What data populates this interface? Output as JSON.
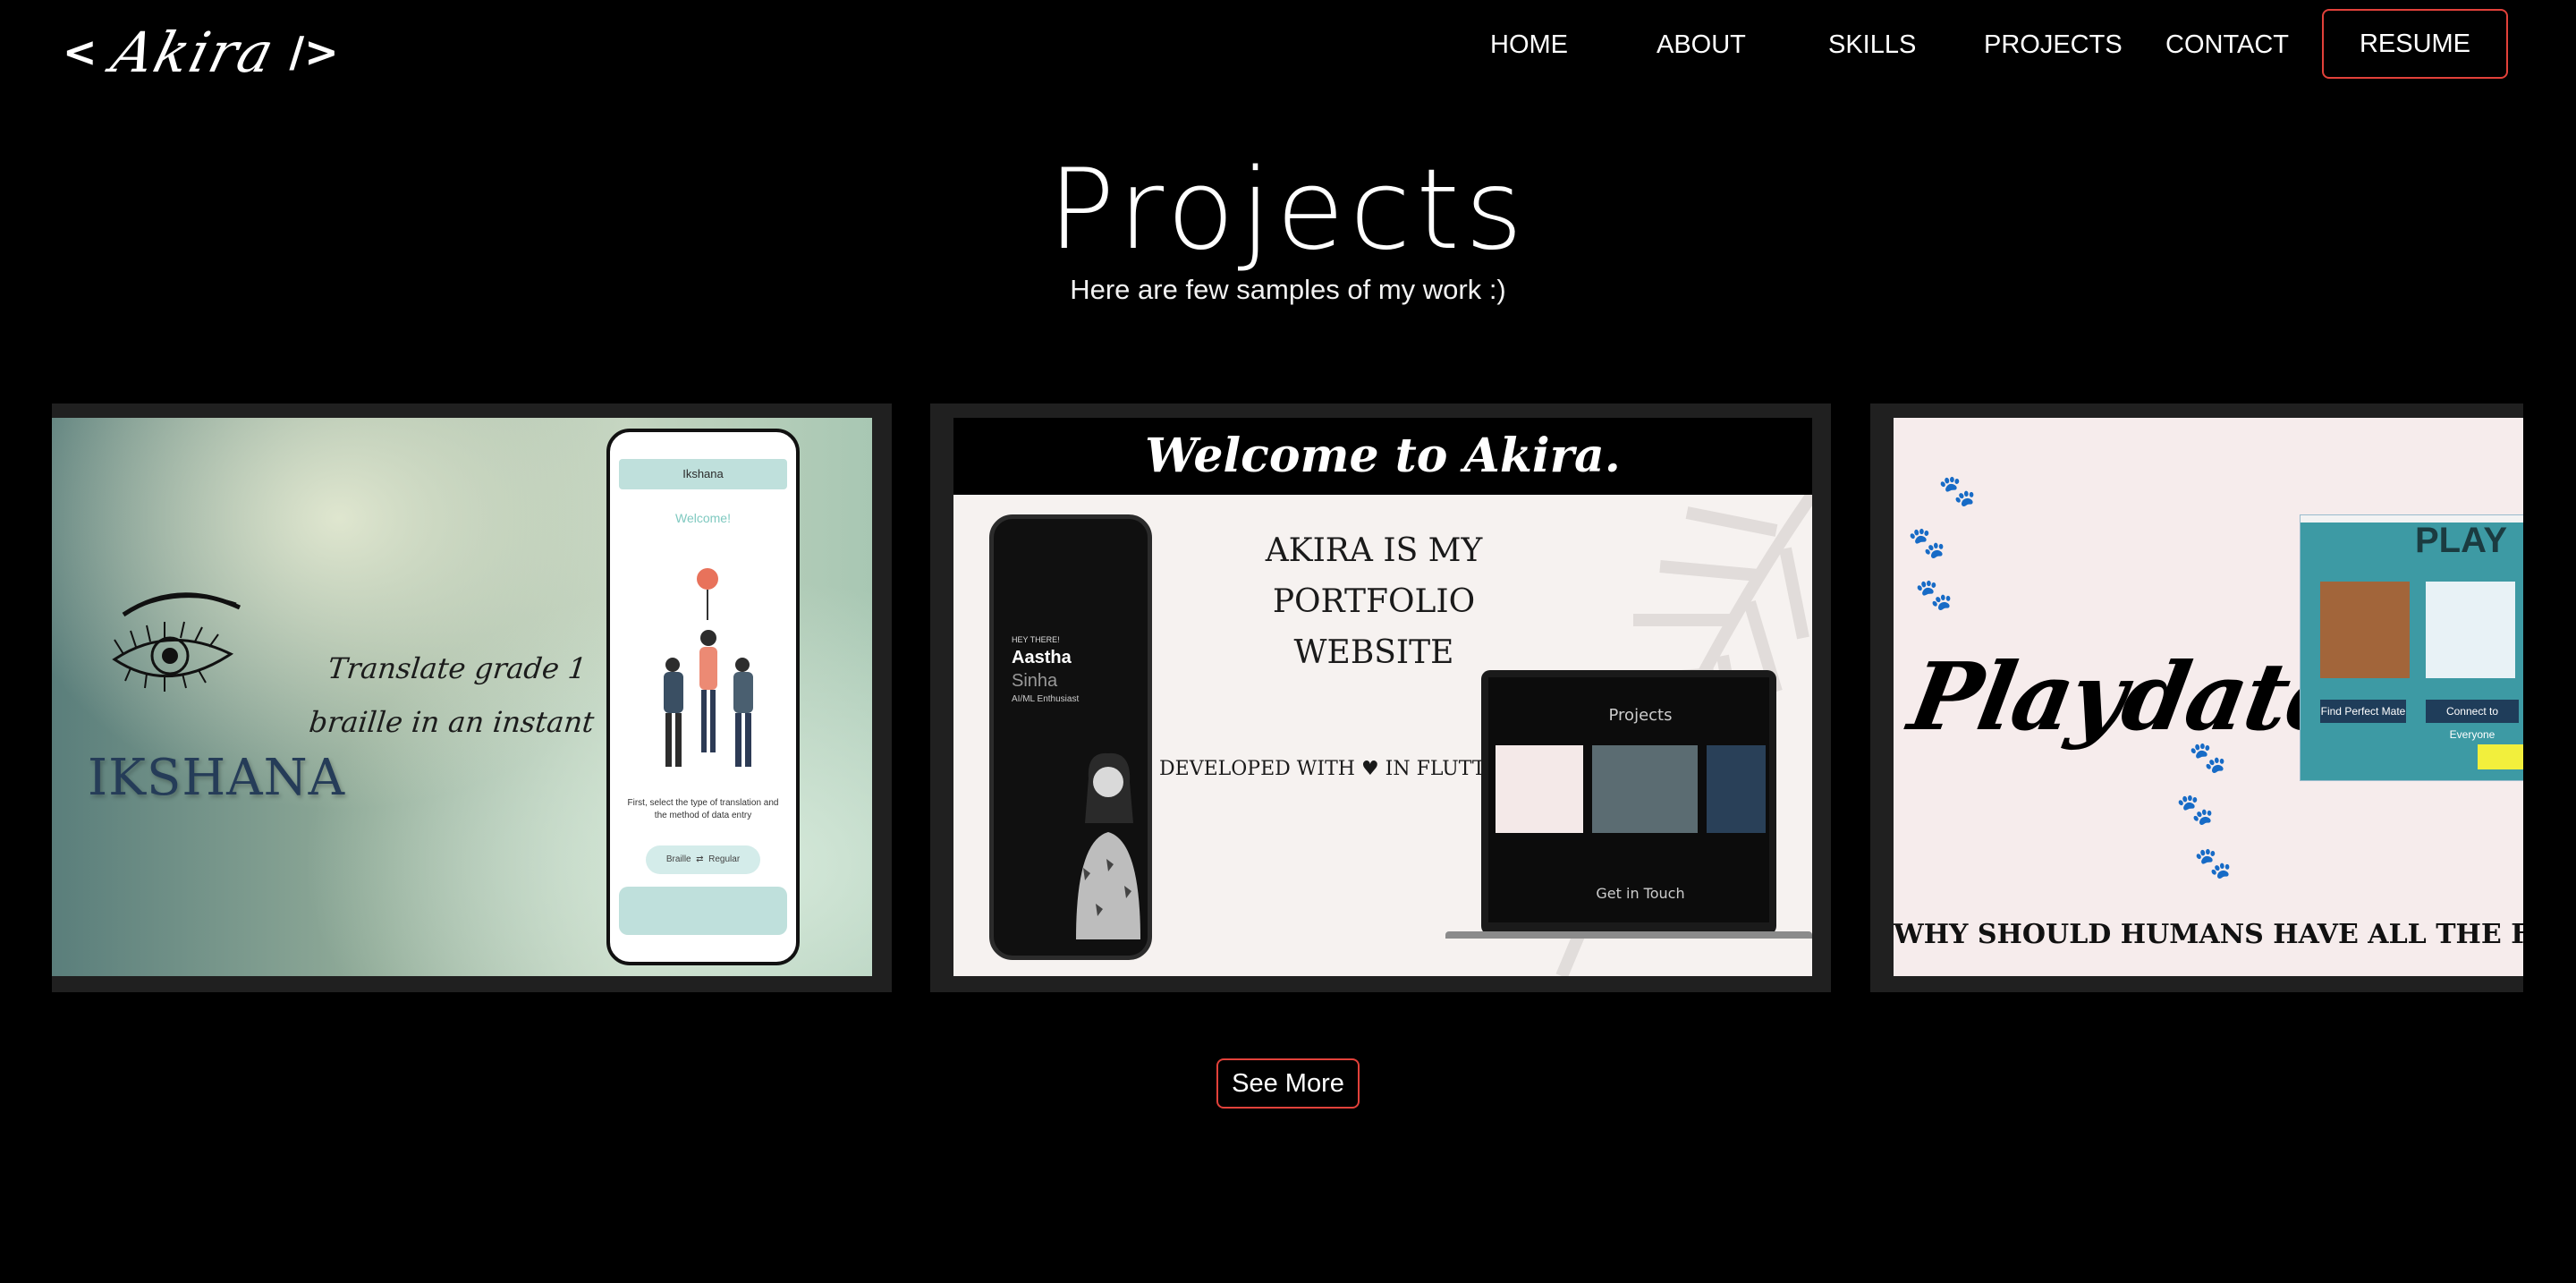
{
  "logo": {
    "open": "<",
    "signature": "Akira",
    "close": "/>"
  },
  "nav": {
    "items": [
      {
        "label": "HOME"
      },
      {
        "label": "ABOUT"
      },
      {
        "label": "SKILLS"
      },
      {
        "label": "PROJECTS"
      },
      {
        "label": "CONTACT"
      }
    ],
    "resume_label": "RESUME"
  },
  "hero": {
    "title": "Projects",
    "subtitle": "Here are few samples of my work :)"
  },
  "projects": [
    {
      "name": "IKSHANA",
      "tagline": "Translate grade 1 braille in an instant",
      "phone": {
        "app_title": "Ikshana",
        "welcome": "Welcome!",
        "hint": "First, select the type of translation and the method of data entry",
        "toggle_left": "Braille",
        "toggle_right": "Regular"
      }
    },
    {
      "banner": "Welcome to Akira.",
      "headline": "AKIRA IS MY PORTFOLIO WEBSITE",
      "developed": "DEVELOPED WITH ♥ IN FLUTTER",
      "phone": {
        "greeting": "HEY THERE!",
        "first_name": "Aastha",
        "last_name": "Sinha",
        "role": "AI/ML Enthusiast"
      },
      "laptop": {
        "heading": "Projects",
        "footer": "Get in Touch"
      }
    },
    {
      "name": "Playdate",
      "tagline": "WHY SHOULD HUMANS HAVE ALL THE FUN",
      "screenshot": {
        "title": "PLAY",
        "button_left": "Find Perfect Mate",
        "button_right": "Connect to Everyone"
      }
    }
  ],
  "see_more_label": "See More",
  "colors": {
    "accent": "#e2413a",
    "background": "#000000",
    "card": "#202020"
  }
}
